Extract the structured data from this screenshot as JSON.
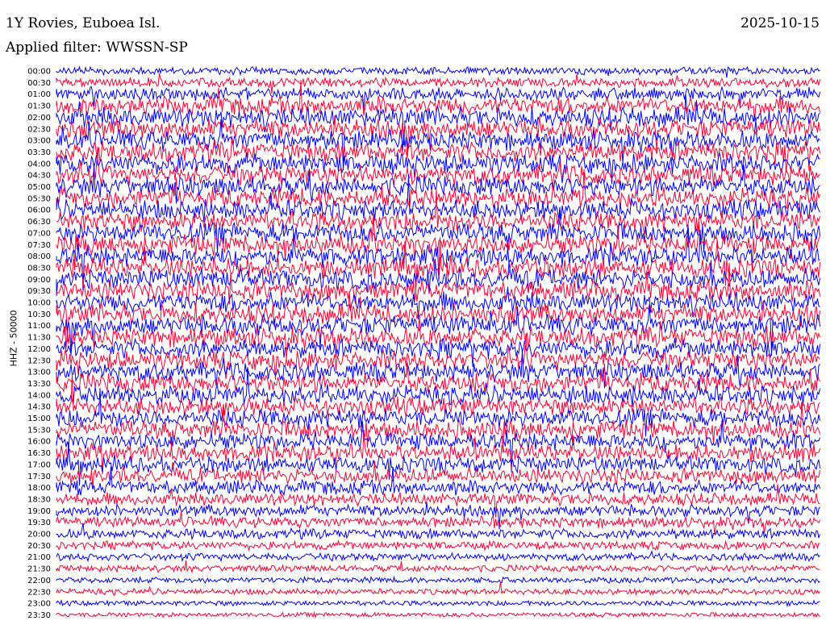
{
  "header": {
    "station": "1Y Rovies, Euboea Isl.",
    "date": "2025-10-15",
    "filter": "Applied filter: WWSSN-SP"
  },
  "colors": {
    "even_trace": "#0000ff",
    "odd_trace": "#ff0033",
    "background": "#ffffff"
  },
  "chart_data": {
    "type": "line",
    "title": "1Y Rovies, Euboea Isl.",
    "subtitle": "Applied filter: WWSSN-SP",
    "ylabel": "HHZ - 50000",
    "grid": false,
    "row_labels": [
      "00:00",
      "00:30",
      "01:00",
      "01:30",
      "02:00",
      "02:30",
      "03:00",
      "03:30",
      "04:00",
      "04:30",
      "05:00",
      "05:30",
      "06:00",
      "06:30",
      "07:00",
      "07:30",
      "08:00",
      "08:30",
      "09:00",
      "09:30",
      "10:00",
      "10:30",
      "11:00",
      "11:30",
      "12:00",
      "12:30",
      "13:00",
      "13:30",
      "14:00",
      "14:30",
      "15:00",
      "15:30",
      "16:00",
      "16:30",
      "17:00",
      "17:30",
      "18:00",
      "18:30",
      "19:00",
      "19:30",
      "20:00",
      "20:30",
      "21:00",
      "21:30",
      "22:00",
      "22:30",
      "23:00",
      "23:30"
    ],
    "trace_colors_alternating": [
      "blue",
      "red"
    ],
    "row_activity": [
      0.3,
      0.4,
      0.6,
      0.9,
      1,
      1,
      1,
      1,
      1,
      1,
      1,
      1,
      1,
      1,
      1,
      1,
      1,
      1,
      1,
      1,
      1,
      1,
      1,
      1,
      0.95,
      0.95,
      0.95,
      0.95,
      0.95,
      0.9,
      0.9,
      0.9,
      0.85,
      0.85,
      0.8,
      0.75,
      0.7,
      0.6,
      0.55,
      0.5,
      0.45,
      0.35,
      0.3,
      0.25,
      0.2,
      0.2,
      0.15,
      0.12
    ]
  }
}
